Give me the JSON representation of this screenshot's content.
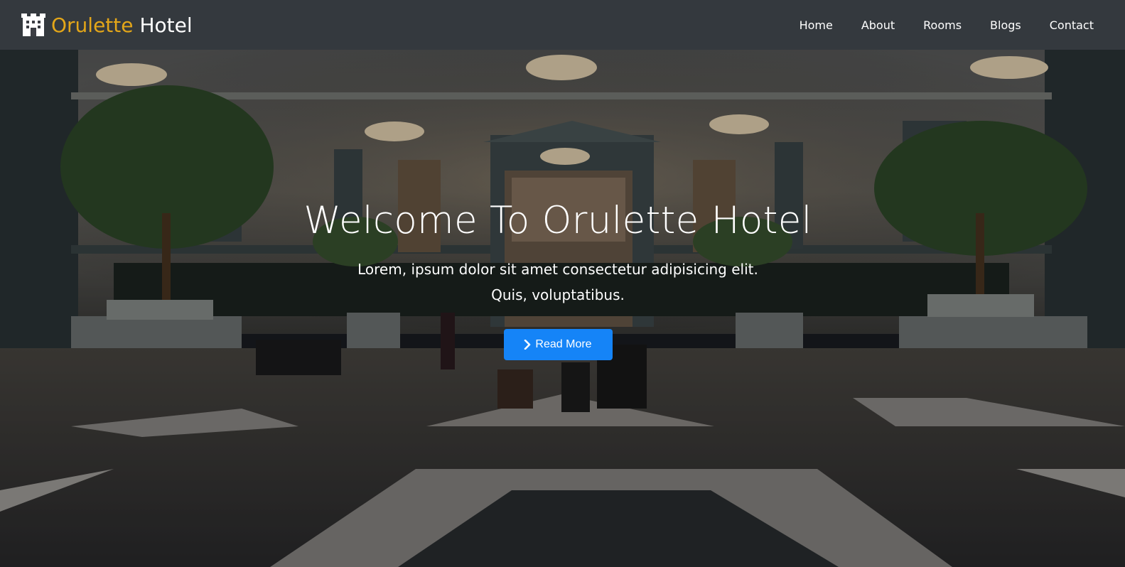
{
  "brand": {
    "word1": "Orulette",
    "word2": "Hotel",
    "icon": "building-icon"
  },
  "nav": {
    "items": [
      {
        "label": "Home"
      },
      {
        "label": "About"
      },
      {
        "label": "Rooms"
      },
      {
        "label": "Blogs"
      },
      {
        "label": "Contact"
      }
    ]
  },
  "hero": {
    "title": "Welcome To Orulette Hotel",
    "subtitle_line1": "Lorem, ipsum dolor sit amet consectetur adipisicing elit.",
    "subtitle_line2": "Quis, voluptatibus.",
    "button_label": "Read More",
    "button_icon": "chevron-right-icon"
  },
  "colors": {
    "brand_accent": "#e3a619",
    "button": "#1584f7",
    "navbar_bg": "#3c3e44"
  }
}
